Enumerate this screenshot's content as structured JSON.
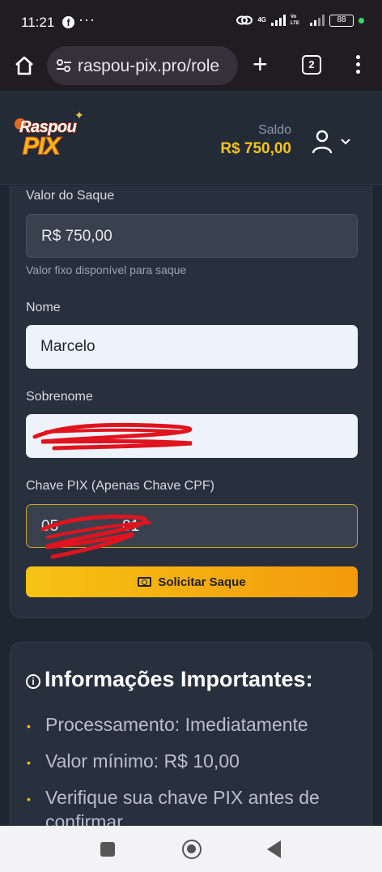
{
  "status_bar": {
    "time": "11:21",
    "notification_icons": [
      "facebook-icon",
      "more-dots-icon"
    ],
    "network_label_top": "4G",
    "network_label_mid": "Vo LTE",
    "battery": "88"
  },
  "browser": {
    "url": "raspou-pix.pro/role",
    "tab_count": "2"
  },
  "header": {
    "logo_line1": "Raspou",
    "logo_line2": "PIX",
    "balance_label": "Saldo",
    "balance_value": "R$ 750,00"
  },
  "withdraw_form": {
    "amount_label": "Valor do Saque",
    "amount_value": "R$ 750,00",
    "amount_hint": "Valor fixo disponível para saque",
    "name_label": "Nome",
    "name_value": "Marcelo",
    "surname_label": "Sobrenome",
    "pix_key_label": "Chave PIX (Apenas Chave CPF)",
    "pix_key_partial": "05",
    "pix_key_partial_end": "81",
    "submit_label": "Solicitar Saque"
  },
  "info": {
    "title": "Informações Importantes:",
    "items": [
      "Processamento: Imediatamente",
      "Valor mínimo: R$ 10,00",
      "Verifique sua chave PIX antes de confirmar"
    ]
  },
  "colors": {
    "accent_yellow": "#f3c41e",
    "button_gradient_start": "#f6c214",
    "button_gradient_end": "#f39a0c",
    "redaction_red": "#e0141e"
  }
}
